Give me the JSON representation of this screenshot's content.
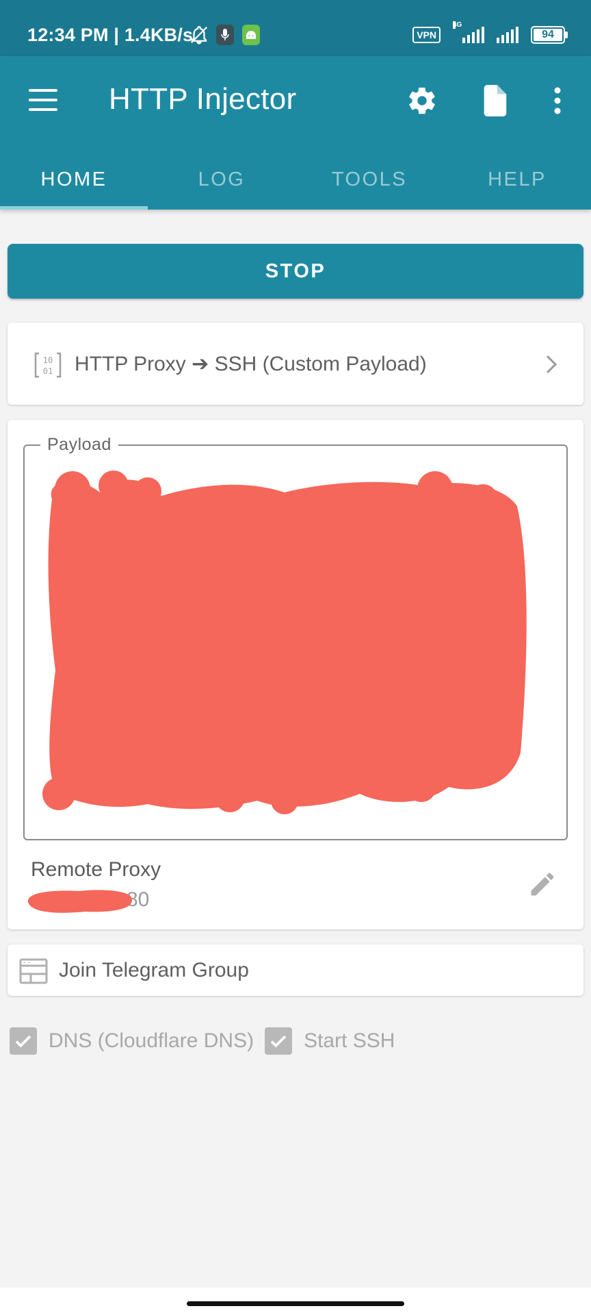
{
  "status_bar": {
    "time_speed": "12:34 PM | 1.4KB/s",
    "vpn": "VPN",
    "network_type": "4G",
    "battery": "94",
    "battery_level": 0.94
  },
  "app_bar": {
    "title": "HTTP Injector",
    "icons": [
      "menu-icon",
      "settings-icon",
      "file-icon",
      "more-vert-icon"
    ]
  },
  "tabs": [
    {
      "label": "HOME",
      "active": true
    },
    {
      "label": "LOG",
      "active": false
    },
    {
      "label": "TOOLS",
      "active": false
    },
    {
      "label": "HELP",
      "active": false
    }
  ],
  "stop_button": {
    "label": "STOP"
  },
  "mode": {
    "label": "HTTP Proxy ➔ SSH (Custom Payload)",
    "icon": "binary-icon"
  },
  "payload": {
    "legend": "Payload"
  },
  "remote_proxy": {
    "label": "Remote Proxy",
    "value_visible": "80"
  },
  "telegram": {
    "label": "Join Telegram Group",
    "icon": "web-layout-icon"
  },
  "checkboxes": [
    {
      "label": "DNS (Cloudflare DNS)",
      "checked": true
    },
    {
      "label": "Start SSH",
      "checked": true
    }
  ],
  "colors": {
    "primary": "#1e8aa2",
    "status_bar": "#1a7890",
    "redaction": "#f4675a",
    "background": "#f3f3f3"
  }
}
